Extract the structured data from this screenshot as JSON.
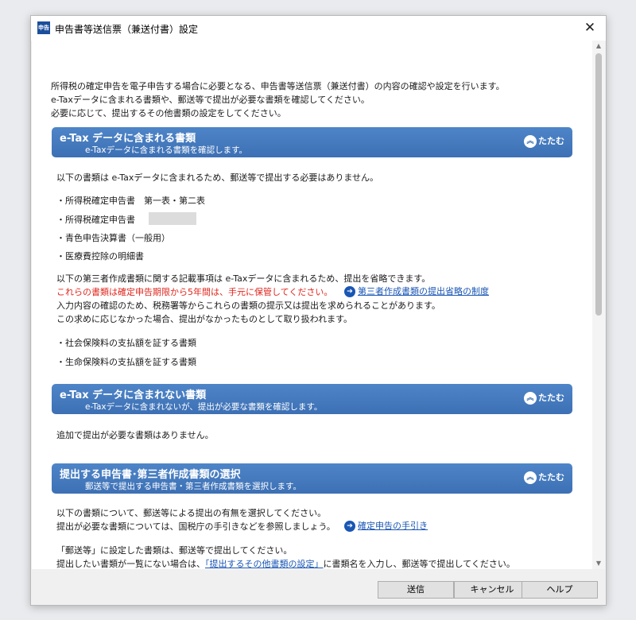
{
  "window": {
    "title": "申告書等送信票（兼送付書）設定",
    "icon_label": "申告",
    "close_glyph": "✕"
  },
  "intro": [
    "所得税の確定申告を電子申告する場合に必要となる、申告書等送信票（兼送付書）の内容の確認や設定を行います。",
    "e-Taxデータに含まれる書類や、郵送等で提出が必要な書類を確認してください。",
    "必要に応じて、提出するその他書類の設定をしてください。"
  ],
  "collapse_label": "たたむ",
  "section1": {
    "title": "e-Tax データに含まれる書類",
    "subtitle": "e-Taxデータに含まれる書類を確認します。",
    "lead": "以下の書類は e-Taxデータに含まれるため、郵送等で提出する必要はありません。",
    "items": [
      "・所得税確定申告書　第一表・第二表",
      "・所得税確定申告書",
      "・青色申告決算書（一般用）",
      "・医療費控除の明細書"
    ],
    "note1": "以下の第三者作成書類に関する記載事項は e-Taxデータに含まれるため、提出を省略できます。",
    "note_red": "これらの書類は確定申告期限から5年間は、手元に保管してください。",
    "link": "第三者作成書類の提出省略の制度",
    "note2": "入力内容の確認のため、税務署等からこれらの書類の提示又は提出を求められることがあります。",
    "note3": "この求めに応じなかった場合、提出がなかったものとして取り扱われます。",
    "items2": [
      "・社会保険料の支払額を証する書類",
      "・生命保険料の支払額を証する書類"
    ]
  },
  "section2": {
    "title": "e-Tax データに含まれない書類",
    "subtitle": "e-Taxデータに含まれないが、提出が必要な書類を確認します。",
    "lead": "追加で提出が必要な書類はありません。"
  },
  "section3": {
    "title": "提出する申告書･第三者作成書類の選択",
    "subtitle": "郵送等で提出する申告書・第三者作成書類を選択します。",
    "line1": "以下の書類について、郵送等による提出の有無を選択してください。",
    "line2": "提出が必要な書類については、国税庁の手引きなどを参照しましょう。",
    "link": "確定申告の手引き",
    "line3": "「郵送等」に設定した書類は、郵送等で提出してください。",
    "line4_pre": "提出したい書類が一覧にない場合は、",
    "line4_link": "「提出するその他書類の設定」",
    "line4_post": "に書類名を入力し、郵送等で提出してください。"
  },
  "buttons": {
    "send": "送信",
    "cancel": "キャンセル",
    "help": "ヘルプ"
  }
}
